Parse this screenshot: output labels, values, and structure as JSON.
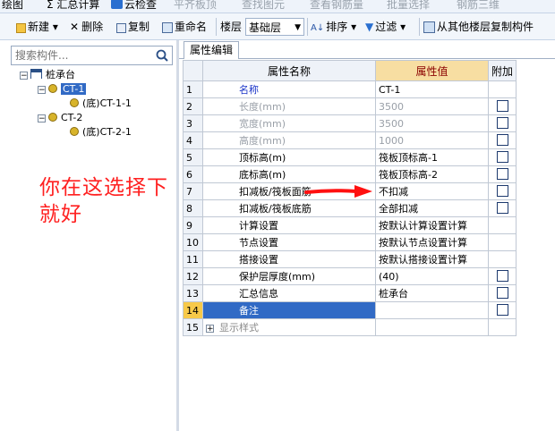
{
  "menubar": {
    "items": [
      {
        "label": "绘图",
        "disabled": false
      },
      {
        "label": "Σ 汇总计算",
        "disabled": false
      },
      {
        "label": "云检查",
        "disabled": false
      },
      {
        "label": "平齐板顶",
        "disabled": true
      },
      {
        "label": "查找图元",
        "disabled": true
      },
      {
        "label": "查看钢筋量",
        "disabled": true
      },
      {
        "label": "批量选择",
        "disabled": true
      },
      {
        "label": "钢筋三维",
        "disabled": true
      }
    ]
  },
  "toolbar": {
    "new_label": "新建",
    "delete_label": "删除",
    "copy_label": "复制",
    "rename_label": "重命名",
    "floor_label": "楼层",
    "floor_value": "基础层",
    "sort_label": "排序",
    "filter_label": "过滤",
    "copy_from_label": "从其他楼层复制构件"
  },
  "search": {
    "placeholder": "搜索构件..."
  },
  "tree": {
    "root": "桩承台",
    "nodes": [
      {
        "label": "CT-1",
        "children": [
          "(底)CT-1-1"
        ],
        "selected": true
      },
      {
        "label": "CT-2",
        "children": [
          "(底)CT-2-1"
        ],
        "selected": false
      }
    ]
  },
  "annotation": {
    "line1": "你在这选择下",
    "line2": "就好"
  },
  "panel": {
    "tab_label": "属性编辑",
    "columns": {
      "name": "属性名称",
      "value": "属性值",
      "extra": "附加"
    },
    "rows": [
      {
        "num": "1",
        "name": "名称",
        "value": "CT-1",
        "check": null,
        "style": "blue"
      },
      {
        "num": "2",
        "name": "长度(mm)",
        "value": "3500",
        "check": false,
        "style": "gray"
      },
      {
        "num": "3",
        "name": "宽度(mm)",
        "value": "3500",
        "check": false,
        "style": "gray"
      },
      {
        "num": "4",
        "name": "高度(mm)",
        "value": "1000",
        "check": false,
        "style": "gray"
      },
      {
        "num": "5",
        "name": "顶标高(m)",
        "value": "筏板顶标高-1",
        "check": false,
        "style": "normal"
      },
      {
        "num": "6",
        "name": "底标高(m)",
        "value": "筏板顶标高-2",
        "check": false,
        "style": "normal"
      },
      {
        "num": "7",
        "name": "扣减板/筏板面筋",
        "value": "不扣减",
        "check": false,
        "style": "normal"
      },
      {
        "num": "8",
        "name": "扣减板/筏板底筋",
        "value": "全部扣减",
        "check": false,
        "style": "normal"
      },
      {
        "num": "9",
        "name": "计算设置",
        "value": "按默认计算设置计算",
        "check": null,
        "style": "normal"
      },
      {
        "num": "10",
        "name": "节点设置",
        "value": "按默认节点设置计算",
        "check": null,
        "style": "normal"
      },
      {
        "num": "11",
        "name": "搭接设置",
        "value": "按默认搭接设置计算",
        "check": null,
        "style": "normal"
      },
      {
        "num": "12",
        "name": "保护层厚度(mm)",
        "value": "(40)",
        "check": false,
        "style": "normal"
      },
      {
        "num": "13",
        "name": "汇总信息",
        "value": "桩承台",
        "check": false,
        "style": "normal"
      },
      {
        "num": "14",
        "name": "备注",
        "value": "",
        "check": false,
        "style": "active"
      },
      {
        "num": "15",
        "name": "显示样式",
        "value": "",
        "check": null,
        "style": "group"
      }
    ]
  },
  "colors": {
    "accent": "#316ac5",
    "annotation": "#ff2020",
    "header_value_bg": "#f7dea2",
    "active_num_bg": "#f7c94a"
  }
}
